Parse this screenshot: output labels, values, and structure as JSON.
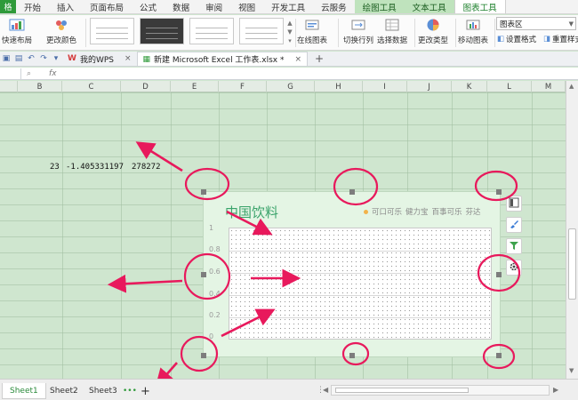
{
  "ribbon": {
    "menu_label": "格",
    "tabs": [
      "开始",
      "插入",
      "页面布局",
      "公式",
      "数据",
      "审阅",
      "视图",
      "开发工具",
      "云服务",
      "绘图工具",
      "文本工具",
      "图表工具"
    ],
    "active_tab": "图表工具",
    "contextual_tabs": [
      "绘图工具",
      "文本工具",
      "图表工具"
    ],
    "buttons": {
      "quick_layout": "快速布局",
      "change_color": "更改颜色",
      "online_chart": "在线图表",
      "switch_row_col": "切换行列",
      "select_data": "选择数据",
      "change_type": "更改类型",
      "move_chart": "移动图表",
      "set_format": "设置格式",
      "reset_style": "重置样式"
    },
    "chart_area_select": "图表区"
  },
  "doc_tabs": {
    "wps_tab": "我的WPS",
    "file_tab": "新建 Microsoft Excel 工作表.xlsx *",
    "add": "+"
  },
  "formula_bar": {
    "fx": "fx"
  },
  "columns": [
    "B",
    "C",
    "D",
    "E",
    "F",
    "G",
    "H",
    "I",
    "J",
    "K",
    "L",
    "M"
  ],
  "cells": {
    "b": "23",
    "c": "-1.405331197",
    "d": "278272"
  },
  "chart": {
    "title": "中国饮料",
    "legend": [
      "可口可乐",
      "健力宝",
      "百事可乐",
      "芬达"
    ]
  },
  "chart_data": {
    "type": "bar",
    "title": "中国饮料",
    "categories": [],
    "series": [
      {
        "name": "可口可乐",
        "values": []
      },
      {
        "name": "健力宝",
        "values": []
      },
      {
        "name": "百事可乐",
        "values": []
      },
      {
        "name": "芬达",
        "values": []
      }
    ],
    "yticks": [
      "1",
      "0.8",
      "0.6",
      "0.4",
      "0.2",
      "0"
    ],
    "ylim": [
      0,
      1
    ],
    "grid": true,
    "legend_position": "top-right"
  },
  "sheets": {
    "tabs": [
      "Sheet1",
      "Sheet2",
      "Sheet3"
    ],
    "active": "Sheet1",
    "more": "•••",
    "add": "+"
  },
  "colors": {
    "sheet_bg": "#cfe6cf",
    "chart_bg": "#e4f5e4",
    "title_color": "#3ba36b",
    "annotation": "#e8195c",
    "ribbon_accent": "#2f9a3a"
  }
}
